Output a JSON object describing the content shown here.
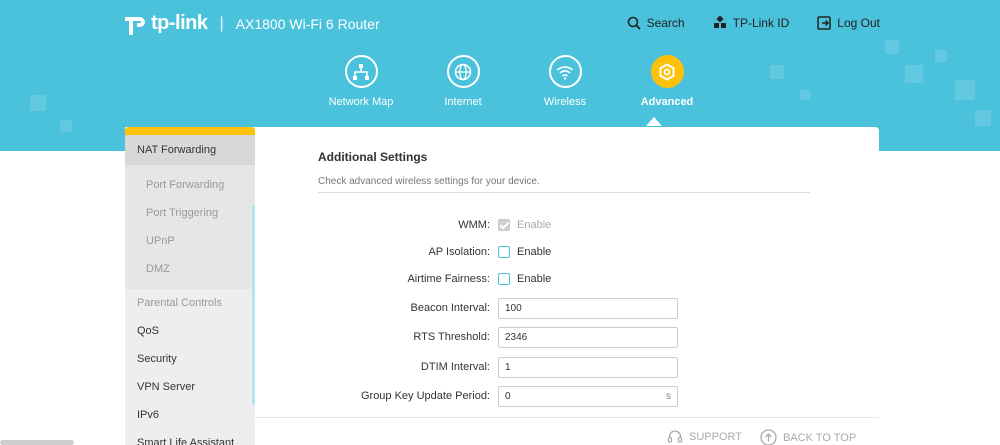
{
  "brand": {
    "logo_text": "tp-link",
    "separator": "|",
    "model": "AX1800 Wi-Fi 6 Router"
  },
  "top_links": [
    {
      "label": "Search",
      "icon": "search-icon"
    },
    {
      "label": "TP-Link ID",
      "icon": "tplink-id-icon"
    },
    {
      "label": "Log Out",
      "icon": "logout-icon"
    }
  ],
  "nav": [
    {
      "label": "Network Map",
      "icon": "network-map-icon",
      "active": false
    },
    {
      "label": "Internet",
      "icon": "globe-icon",
      "active": false
    },
    {
      "label": "Wireless",
      "icon": "wifi-icon",
      "active": false
    },
    {
      "label": "Advanced",
      "icon": "gear-icon",
      "active": true
    }
  ],
  "sidebar": {
    "active": "NAT Forwarding",
    "sub_items": [
      "Port Forwarding",
      "Port Triggering",
      "UPnP",
      "DMZ"
    ],
    "items": [
      "Parental Controls",
      "QoS",
      "Security",
      "VPN Server",
      "IPv6",
      "Smart Life Assistant"
    ]
  },
  "main": {
    "title": "Additional Settings",
    "description": "Check advanced wireless settings for your device.",
    "wmm": {
      "label": "WMM:",
      "option": "Enable",
      "checked": true,
      "disabled": true
    },
    "ap_isolation": {
      "label": "AP Isolation:",
      "option": "Enable",
      "checked": false
    },
    "airtime_fairness": {
      "label": "Airtime Fairness:",
      "option": "Enable",
      "checked": false
    },
    "beacon_interval": {
      "label": "Beacon Interval:",
      "value": "100"
    },
    "rts_threshold": {
      "label": "RTS Threshold:",
      "value": "2346"
    },
    "dtim_interval": {
      "label": "DTIM Interval:",
      "value": "1"
    },
    "group_key": {
      "label": "Group Key Update Period:",
      "value": "0",
      "unit": "s"
    }
  },
  "footer": {
    "support": "SUPPORT",
    "back_to_top": "BACK TO TOP"
  },
  "colors": {
    "header": "#4bc2dc",
    "accent": "#ffc107",
    "sidebar": "#eeeeee"
  }
}
